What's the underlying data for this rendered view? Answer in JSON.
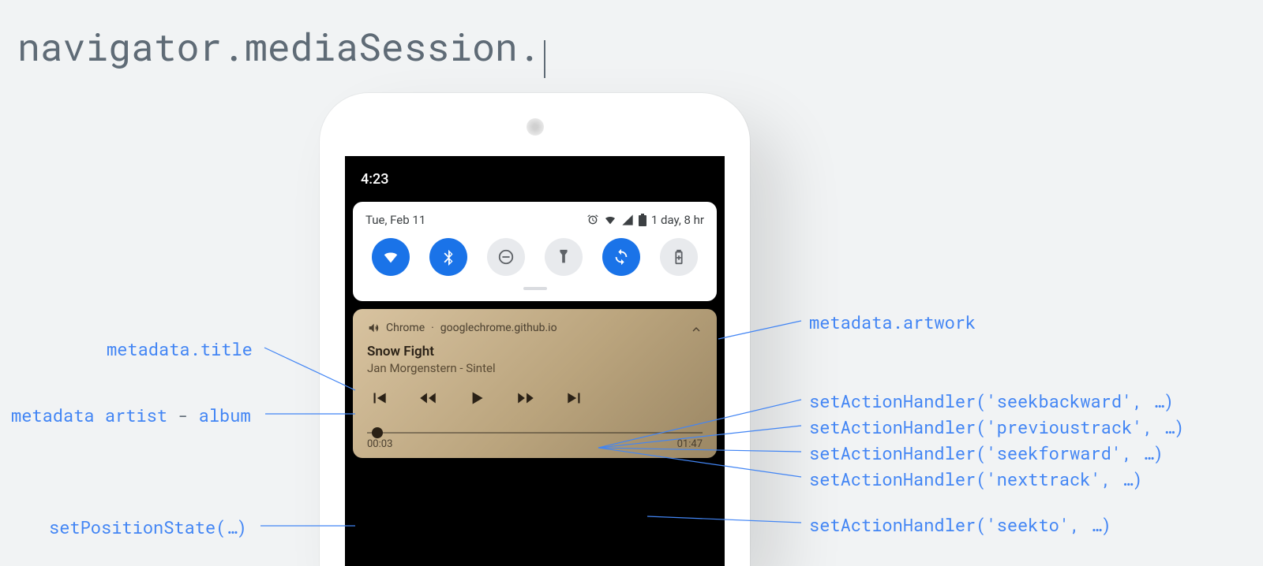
{
  "header": {
    "code": "navigator.mediaSession."
  },
  "phone": {
    "status_time": "4:23",
    "qs_date": "Tue, Feb 11",
    "qs_duration": "1 day, 8 hr"
  },
  "media": {
    "app": "Chrome",
    "source": "googlechrome.github.io",
    "separator": "·",
    "title": "Snow Fight",
    "artist_album": "Jan Morgenstern - Sintel",
    "pos": "00:03",
    "dur": "01:47"
  },
  "annotations": {
    "left": {
      "title": "metadata.title",
      "artist": "metadata artist",
      "dash": " - ",
      "album": "album",
      "position": "setPositionState(…)"
    },
    "right": {
      "artwork": "metadata.artwork",
      "seekback": "setActionHandler('seekbackward', …)",
      "prev": "setActionHandler('previoustrack', …)",
      "seekfwd": "setActionHandler('seekforward', …)",
      "next": "setActionHandler('nexttrack', …)",
      "seekto": "setActionHandler('seekto', …)"
    }
  }
}
